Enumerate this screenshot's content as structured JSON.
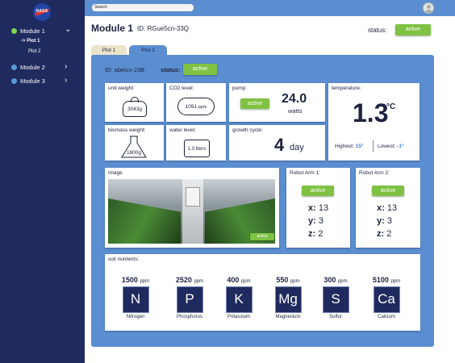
{
  "sidebar": {
    "logo_text": "NASA",
    "modules": [
      {
        "label": "Module 1",
        "active": true,
        "subitems": [
          {
            "label": "-> Plot 1",
            "active": true
          },
          {
            "label": "Plot 2",
            "active": false
          }
        ]
      },
      {
        "label": "Module 2",
        "active": false
      },
      {
        "label": "Module 3",
        "active": false
      }
    ]
  },
  "topbar": {
    "search_placeholder": "Search"
  },
  "header": {
    "title": "Module 1",
    "id_label": "ID: RGue5cn-33Q",
    "status_label": "status:",
    "status_value": "active"
  },
  "tabs": [
    {
      "label": "Plot 1",
      "active": false
    },
    {
      "label": "Plot 2",
      "active": true
    }
  ],
  "plot": {
    "id_label": "ID: abeicx-23B",
    "status_label": "status:",
    "status_value": "active"
  },
  "cards": {
    "unit_weight": {
      "label": "unit weight:",
      "value": "3043",
      "unit": "g"
    },
    "co2": {
      "label": "CO2 level:",
      "value": "1091",
      "unit": "ppm"
    },
    "pump": {
      "label": "pump:",
      "status": "active",
      "value": "24.0",
      "unit": "watts"
    },
    "temperature": {
      "label": "temperature:",
      "value": "1.3",
      "unit": "°C",
      "highest_label": "Highest:",
      "highest_value": "15°",
      "lowest_label": "Lowest:",
      "lowest_value": "-1°"
    },
    "biomass": {
      "label": "biomass weight:",
      "value": "1800",
      "unit": "g"
    },
    "water": {
      "label": "water level:",
      "value": "1.3",
      "unit": "liters"
    },
    "growth": {
      "label": "growth cycle:",
      "value": "4",
      "unit": "day"
    },
    "image": {
      "label": "image",
      "status": "active"
    },
    "arm1": {
      "label": "Robot Arm 1:",
      "status": "active",
      "x_label": "x:",
      "x": "13",
      "y_label": "y:",
      "y": "3",
      "z_label": "z:",
      "z": "2"
    },
    "arm2": {
      "label": "Robot Arm 2:",
      "status": "active",
      "x_label": "x:",
      "x": "13",
      "y_label": "y:",
      "y": "3",
      "z_label": "z:",
      "z": "2"
    }
  },
  "nutrients": {
    "label": "soil nutrients:",
    "unit": "ppm",
    "items": [
      {
        "value": "1500",
        "symbol": "N",
        "name": "Nitrogen"
      },
      {
        "value": "2520",
        "symbol": "P",
        "name": "Phosphorus"
      },
      {
        "value": "400",
        "symbol": "K",
        "name": "Potassium"
      },
      {
        "value": "550",
        "symbol": "Mg",
        "name": "Magnesium"
      },
      {
        "value": "300",
        "symbol": "S",
        "name": "Sulfur"
      },
      {
        "value": "5100",
        "symbol": "Ca",
        "name": "Calcium"
      }
    ]
  },
  "colors": {
    "sidebar": "#1f2a5e",
    "accent_blue": "#5b8ed1",
    "active_green": "#7fc243"
  }
}
